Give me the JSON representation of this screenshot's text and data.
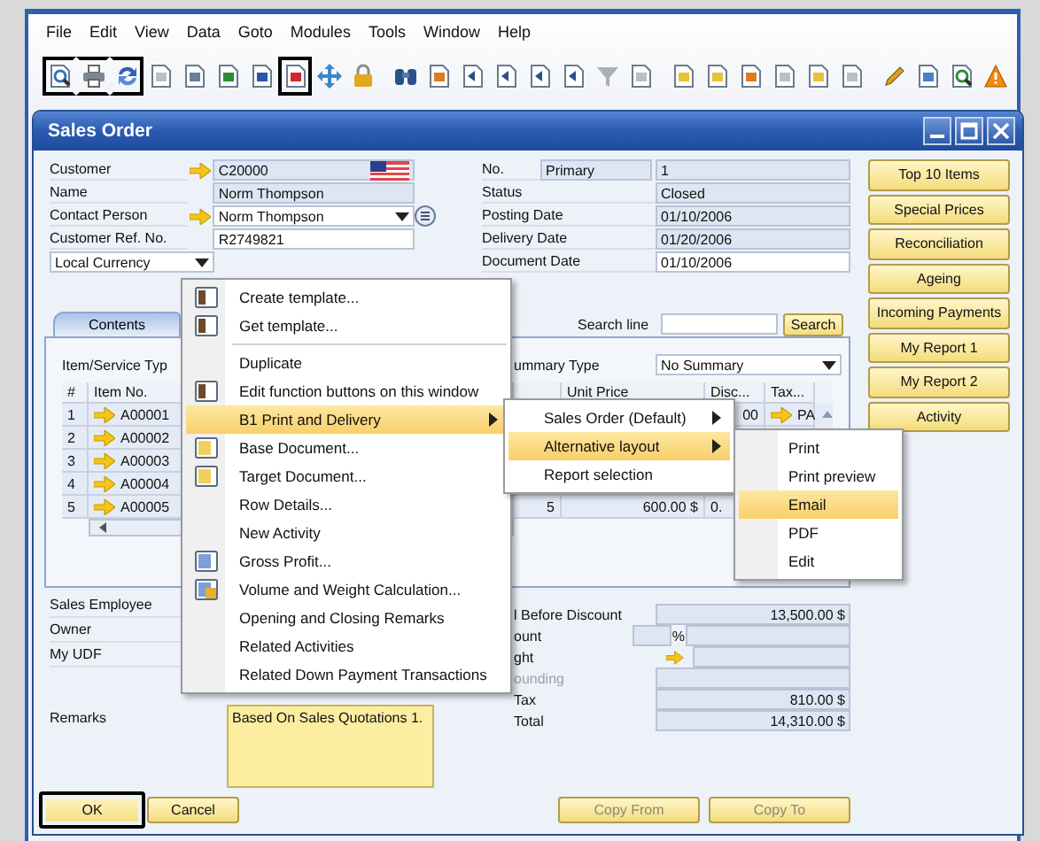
{
  "menu_bar": [
    "File",
    "Edit",
    "View",
    "Data",
    "Goto",
    "Modules",
    "Tools",
    "Window",
    "Help"
  ],
  "toolbar": {
    "groups": [
      {
        "buttons": [
          {
            "kind": "preview",
            "highlighted": true
          },
          {
            "kind": "print",
            "highlighted": true
          },
          {
            "kind": "refresh",
            "highlighted": true
          },
          {
            "kind": "doc",
            "highlighted": false
          },
          {
            "kind": "fax",
            "highlighted": false
          },
          {
            "kind": "excel",
            "highlighted": false
          },
          {
            "kind": "word",
            "highlighted": false
          },
          {
            "kind": "pdf",
            "highlighted": true
          },
          {
            "kind": "nav",
            "highlighted": false
          },
          {
            "kind": "lock",
            "highlighted": false
          }
        ]
      },
      {
        "buttons": [
          {
            "kind": "binoculars",
            "highlighted": false
          },
          {
            "kind": "orange",
            "highlighted": false
          },
          {
            "kind": "arrowdoc",
            "highlighted": false
          },
          {
            "kind": "arrowdoc",
            "highlighted": false
          },
          {
            "kind": "arrowdoc",
            "highlighted": false
          },
          {
            "kind": "arrowdoc",
            "highlighted": false
          },
          {
            "kind": "funnel",
            "highlighted": false
          },
          {
            "kind": "doc",
            "highlighted": false
          }
        ]
      },
      {
        "buttons": [
          {
            "kind": "yellowdoc",
            "highlighted": false
          },
          {
            "kind": "yellowdoc",
            "highlighted": false
          },
          {
            "kind": "orange",
            "highlighted": false
          },
          {
            "kind": "doc",
            "highlighted": false
          },
          {
            "kind": "yellowdoc",
            "highlighted": false
          },
          {
            "kind": "doc",
            "highlighted": false
          }
        ]
      },
      {
        "buttons": [
          {
            "kind": "pencil",
            "highlighted": false
          },
          {
            "kind": "gear",
            "highlighted": false
          },
          {
            "kind": "query",
            "highlighted": false
          },
          {
            "kind": "warning",
            "highlighted": false
          }
        ]
      }
    ]
  },
  "window": {
    "title": "Sales Order"
  },
  "header": {
    "left": [
      {
        "label": "Customer",
        "value": "C20000",
        "editable": false,
        "link": true,
        "flag": true,
        "dropdown": false,
        "list_button": false
      },
      {
        "label": "Name",
        "value": "Norm Thompson",
        "editable": false,
        "link": false,
        "flag": false,
        "dropdown": false,
        "list_button": false
      },
      {
        "label": "Contact Person",
        "value": "Norm Thompson",
        "editable": true,
        "link": true,
        "flag": false,
        "dropdown": true,
        "list_button": true
      },
      {
        "label": "Customer Ref. No.",
        "value": "R2749821",
        "editable": true,
        "link": false,
        "flag": false,
        "dropdown": false,
        "list_button": false
      }
    ],
    "currency": "Local Currency",
    "right": [
      {
        "label": "No.",
        "series": "Primary",
        "value": "1",
        "editable": false
      },
      {
        "label": "Status",
        "value": "Closed",
        "editable": false
      },
      {
        "label": "Posting Date",
        "value": "01/10/2006",
        "editable": false
      },
      {
        "label": "Delivery Date",
        "value": "01/20/2006",
        "editable": false
      },
      {
        "label": "Document Date",
        "value": "01/10/2006",
        "editable": true
      }
    ]
  },
  "side_buttons": [
    "Top 10 Items",
    "Special Prices",
    "Reconciliation",
    "Ageing",
    "Incoming Payments",
    "My Report 1",
    "My Report 2",
    "Activity"
  ],
  "tabs": [
    {
      "label": "Contents",
      "selected": true
    }
  ],
  "search": {
    "label": "Search line",
    "button": "Search"
  },
  "matrix": {
    "type_label": "Item/Service Typ",
    "summary_label": "ummary Type",
    "summary_value": "No Summary",
    "columns": {
      "number": "#",
      "item_no": "Item No.",
      "unit_price": "Unit Price",
      "discount": "Disc...",
      "tax_code": "Tax..."
    },
    "rows": [
      {
        "number": "1",
        "item_no": "A00001",
        "discount": "00",
        "tax_code": "PA"
      },
      {
        "number": "2",
        "item_no": "A00002"
      },
      {
        "number": "3",
        "item_no": "A00003"
      },
      {
        "number": "4",
        "item_no": "A00004"
      },
      {
        "number": "5",
        "item_no": "A00005",
        "column_4": "5",
        "unit_price": "600.00 $",
        "discount": "0."
      }
    ]
  },
  "lower_fields": [
    "Sales Employee",
    "Owner",
    "My UDF"
  ],
  "remarks": {
    "label": "Remarks",
    "value": "Based On Sales Quotations 1."
  },
  "totals": [
    {
      "kind": "amount",
      "label": "l Before Discount",
      "value": "13,500.00 $",
      "disabled": false
    },
    {
      "kind": "percent",
      "label": "ount",
      "unit": "%",
      "disabled": false
    },
    {
      "kind": "link",
      "label": "ght",
      "disabled": false
    },
    {
      "kind": "amount",
      "label": "ounding",
      "disabled": true
    },
    {
      "kind": "amount",
      "label": "Tax",
      "value": "810.00 $",
      "disabled": false
    },
    {
      "kind": "amount",
      "label": "Total",
      "value": "14,310.00 $",
      "disabled": false
    }
  ],
  "actions": [
    {
      "label": "OK",
      "highlighted": true,
      "disabled": false
    },
    {
      "label": "Cancel",
      "highlighted": false,
      "disabled": false
    }
  ],
  "copy_buttons": [
    {
      "label": "Copy From",
      "disabled": true
    },
    {
      "label": "Copy To",
      "disabled": true
    }
  ],
  "context_menu": {
    "groups": [
      {
        "items": [
          {
            "label": "Create template...",
            "kind": "template",
            "selected": false
          },
          {
            "label": "Get template...",
            "kind": "template",
            "selected": false
          }
        ]
      },
      {
        "items": [
          {
            "label": "Duplicate",
            "kind": "plain",
            "selected": false
          },
          {
            "label": "Edit function buttons on this window",
            "kind": "template",
            "selected": false
          },
          {
            "label": "B1 Print and Delivery",
            "kind": "submenu",
            "selected": true
          },
          {
            "label": "Base Document...",
            "kind": "document",
            "selected": false
          },
          {
            "label": "Target Document...",
            "kind": "document",
            "selected": false
          },
          {
            "label": "Row Details...",
            "kind": "plain",
            "selected": false
          },
          {
            "label": "New Activity",
            "kind": "plain",
            "selected": false
          },
          {
            "label": "Gross Profit...",
            "kind": "profit",
            "selected": false
          },
          {
            "label": "Volume and Weight Calculation...",
            "kind": "volume",
            "selected": false
          },
          {
            "label": "Opening and Closing Remarks",
            "kind": "plain",
            "selected": false
          },
          {
            "label": "Related Activities",
            "kind": "plain",
            "selected": false
          },
          {
            "label": "Related Down Payment Transactions",
            "kind": "plain",
            "selected": false
          }
        ]
      }
    ]
  },
  "print_menu": [
    {
      "label": "Sales Order (Default)",
      "kind": "submenu",
      "selected": false
    },
    {
      "label": "Alternative layout",
      "kind": "submenu",
      "selected": true
    },
    {
      "label": "Report selection",
      "kind": "plain",
      "selected": false
    }
  ],
  "layout_menu": [
    {
      "label": "Print",
      "selected": false
    },
    {
      "label": "Print preview",
      "selected": false
    },
    {
      "label": "Email",
      "selected": true
    },
    {
      "label": "PDF",
      "selected": false
    },
    {
      "label": "Edit",
      "selected": false
    }
  ]
}
